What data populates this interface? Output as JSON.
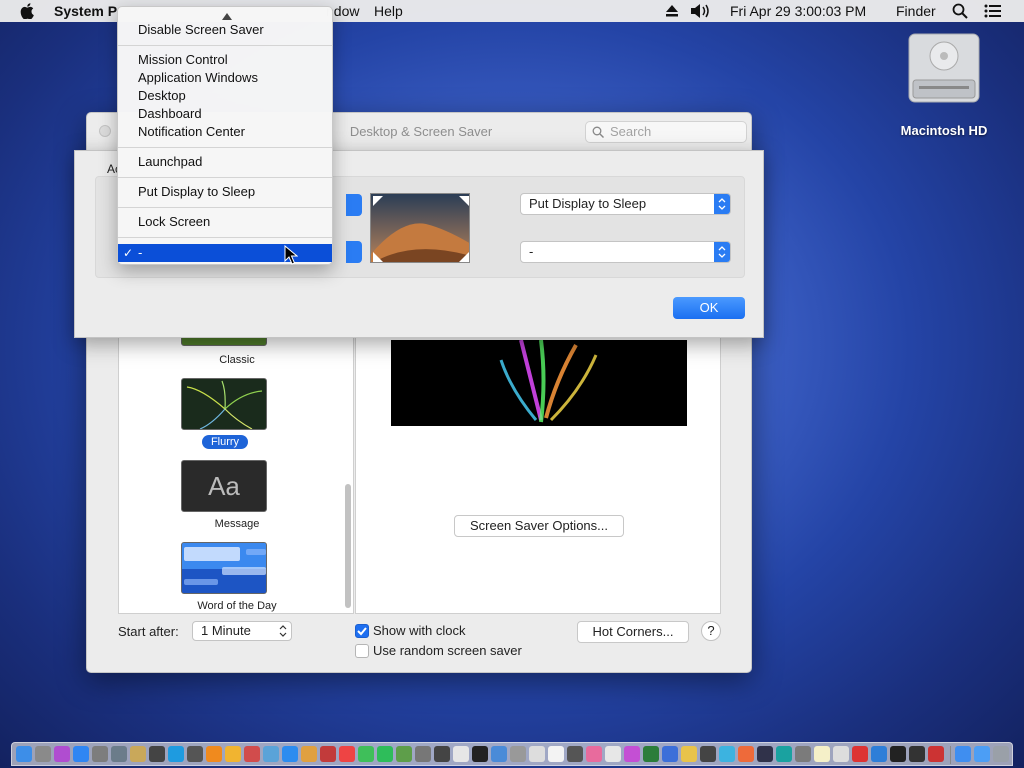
{
  "menubar": {
    "app_name": "System P",
    "window_menu": "ndow",
    "help_menu": "Help",
    "clock": "Fri Apr 29  3:00:03 PM",
    "finder": "Finder"
  },
  "desktop": {
    "hd_label": "Macintosh HD"
  },
  "window": {
    "title": "Desktop & Screen Saver",
    "search_placeholder": "Search",
    "savers": {
      "classic": "Classic",
      "flurry": "Flurry",
      "message": "Message",
      "message_glyph": "Aa",
      "word": "Word of the Day"
    },
    "screen_saver_options": "Screen Saver Options...",
    "start_after_label": "Start after:",
    "start_after_value": "1 Minute",
    "show_with_clock": "Show with clock",
    "use_random": "Use random screen saver",
    "hot_corners": "Hot Corners...",
    "help": "?"
  },
  "sheet": {
    "active_corners_label": "Ac",
    "right_top_value": "Put Display to Sleep",
    "right_bottom_value": "-",
    "ok": "OK"
  },
  "menu": {
    "items": {
      "disable_screen_saver": "Disable Screen Saver",
      "mission_control": "Mission Control",
      "application_windows": "Application Windows",
      "desktop": "Desktop",
      "dashboard": "Dashboard",
      "notification_center": "Notification Center",
      "launchpad": "Launchpad",
      "put_display_to_sleep": "Put Display to Sleep",
      "lock_screen": "Lock Screen",
      "dash": "-"
    },
    "checkmark": "✓"
  },
  "colors": {
    "accent": "#1e6ff0",
    "menu_highlight": "#0b4fd8"
  }
}
